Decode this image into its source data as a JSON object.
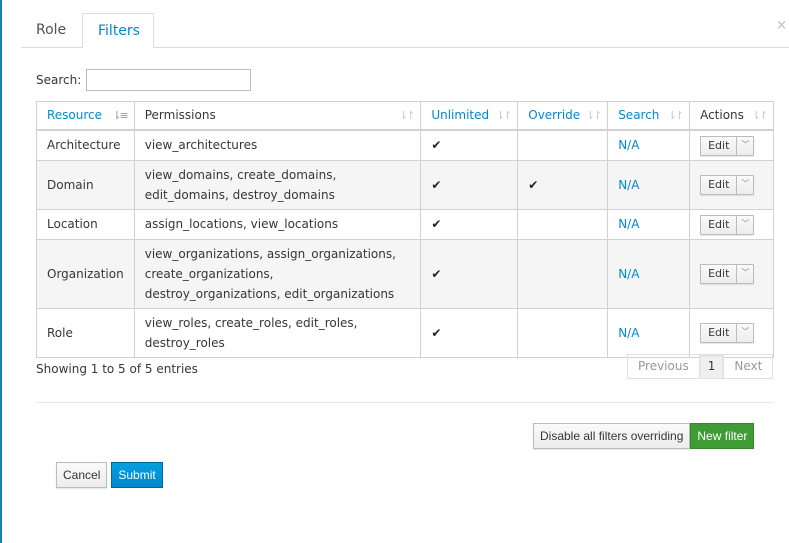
{
  "tabs": [
    {
      "label": "Role",
      "active": false
    },
    {
      "label": "Filters",
      "active": true
    }
  ],
  "close_icon": "×",
  "search": {
    "label": "Search:",
    "value": "",
    "placeholder": ""
  },
  "table": {
    "columns": [
      {
        "label": "Resource",
        "link": true,
        "sort": "ascending"
      },
      {
        "label": "Permissions",
        "link": false,
        "sort": "none"
      },
      {
        "label": "Unlimited",
        "link": true,
        "sort": "none"
      },
      {
        "label": "Override",
        "link": true,
        "sort": "none"
      },
      {
        "label": "Search",
        "link": true,
        "sort": "none"
      },
      {
        "label": "Actions",
        "link": false,
        "sort": "none"
      }
    ],
    "rows": [
      {
        "resource": "Architecture",
        "permissions": "view_architectures",
        "unlimited": "✔",
        "override": "",
        "search": "N/A",
        "edit": "Edit"
      },
      {
        "resource": "Domain",
        "permissions": "view_domains, create_domains, edit_domains, destroy_domains",
        "unlimited": "✔",
        "override": "✔",
        "search": "N/A",
        "edit": "Edit"
      },
      {
        "resource": "Location",
        "permissions": "assign_locations, view_locations",
        "unlimited": "✔",
        "override": "",
        "search": "N/A",
        "edit": "Edit"
      },
      {
        "resource": "Organization",
        "permissions": "view_organizations, assign_organizations, create_organizations, destroy_organizations, edit_organizations",
        "unlimited": "✔",
        "override": "",
        "search": "N/A",
        "edit": "Edit"
      },
      {
        "resource": "Role",
        "permissions": "view_roles, create_roles, edit_roles, destroy_roles",
        "unlimited": "✔",
        "override": "",
        "search": "N/A",
        "edit": "Edit"
      }
    ]
  },
  "info": "Showing 1 to 5 of 5 entries",
  "pagination": {
    "previous": "Previous",
    "current": "1",
    "next": "Next"
  },
  "buttons": {
    "disable_overriding": "Disable all filters overriding",
    "new_filter": "New filter",
    "cancel": "Cancel",
    "submit": "Submit"
  },
  "colors": {
    "link": "#0088ce",
    "success": "#3f9c35",
    "primary": "#0088ce"
  }
}
